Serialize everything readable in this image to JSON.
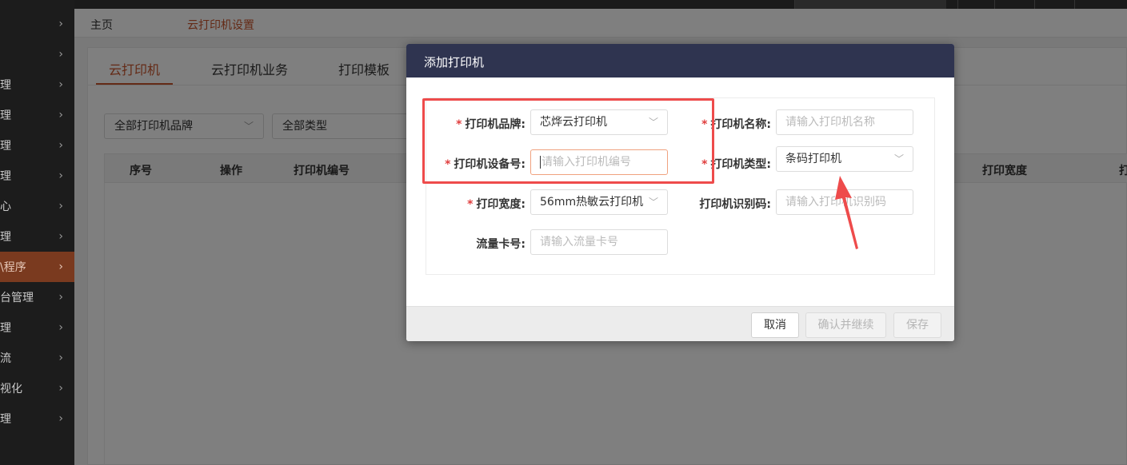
{
  "sidebar": {
    "items": [
      {
        "label": "",
        "chevron": "›"
      },
      {
        "label": "",
        "chevron": "›"
      },
      {
        "label": "理",
        "chevron": "›"
      },
      {
        "label": "理",
        "chevron": "›"
      },
      {
        "label": "理",
        "chevron": "›"
      },
      {
        "label": "理",
        "chevron": "›"
      },
      {
        "label": "心",
        "chevron": "›"
      },
      {
        "label": "理",
        "chevron": "›"
      },
      {
        "label": "\\程序",
        "chevron": "›"
      },
      {
        "label": "台管理",
        "chevron": "›"
      },
      {
        "label": "理",
        "chevron": "›"
      },
      {
        "label": "流",
        "chevron": "›"
      },
      {
        "label": "视化",
        "chevron": "›"
      },
      {
        "label": "理",
        "chevron": "›"
      }
    ]
  },
  "breadcrumb": {
    "home": "主页",
    "current": "云打印机设置"
  },
  "tabs": [
    "云打印机",
    "云打印机业务",
    "打印模板"
  ],
  "filters": {
    "brand": "全部打印机品牌",
    "type": "全部类型"
  },
  "table": {
    "columns": [
      "序号",
      "操作",
      "打印机编号",
      "打印宽度",
      "打"
    ]
  },
  "modal": {
    "title": "添加打印机",
    "fields": {
      "brand": {
        "label": "打印机品牌:",
        "value": "芯烨云打印机",
        "required": true
      },
      "name": {
        "label": "打印机名称:",
        "placeholder": "请输入打印机名称",
        "required": true
      },
      "device_no": {
        "label": "打印机设备号:",
        "placeholder": "请输入打印机编号",
        "required": true
      },
      "type": {
        "label": "打印机类型:",
        "value": "条码打印机",
        "required": true
      },
      "width": {
        "label": "打印宽度:",
        "value": "56mm热敏云打印机",
        "required": true
      },
      "ident_code": {
        "label": "打印机识别码:",
        "placeholder": "请输入打印机识别码",
        "required": false
      },
      "flow_card": {
        "label": "流量卡号:",
        "placeholder": "请输入流量卡号",
        "required": false
      }
    },
    "buttons": {
      "cancel": "取消",
      "confirm_continue": "确认并继续",
      "save": "保存"
    }
  },
  "icons": {
    "chevron_right": "chevron-right-icon",
    "chevron_down": "chevron-down-icon"
  },
  "colors": {
    "accent": "#c8552c",
    "modal_header": "#2f3450",
    "required": "#e03e3e",
    "annotation": "#ee4b4b"
  }
}
